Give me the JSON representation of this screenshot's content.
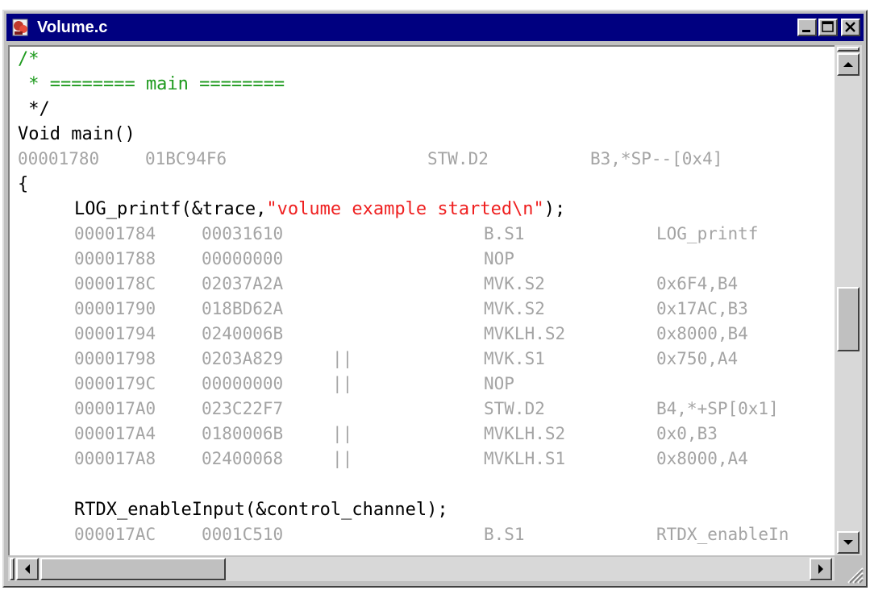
{
  "window": {
    "title": "Volume.c",
    "icon": "ccs-source-file-icon",
    "controls": [
      "minimize-icon",
      "maximize-icon",
      "close-icon"
    ]
  },
  "code": {
    "comment": [
      "/*",
      " * ======== main ========",
      " */"
    ],
    "main_signature": "Void main()",
    "main_asm": [
      "00001780",
      "01BC94F6",
      "",
      "STW.D2",
      "B3,*SP--[0x4]"
    ],
    "open_brace": "{",
    "log_call_prefix": "LOG_printf(&trace,",
    "log_call_string": "\"volume example started\\n\"",
    "log_call_suffix": ");",
    "log_asm": [
      [
        "00001784",
        "00031610",
        "",
        "B.S1",
        "LOG_printf"
      ],
      [
        "00001788",
        "00000000",
        "",
        "NOP",
        ""
      ],
      [
        "0000178C",
        "02037A2A",
        "",
        "MVK.S2",
        "0x6F4,B4"
      ],
      [
        "00001790",
        "018BD62A",
        "",
        "MVK.S2",
        "0x17AC,B3"
      ],
      [
        "00001794",
        "0240006B",
        "",
        "MVKLH.S2",
        "0x8000,B4"
      ],
      [
        "00001798",
        "0203A829",
        "||",
        "MVK.S1",
        "0x750,A4"
      ],
      [
        "0000179C",
        "00000000",
        "||",
        "NOP",
        ""
      ],
      [
        "000017A0",
        "023C22F7",
        "",
        "STW.D2",
        "B4,*+SP[0x1]"
      ],
      [
        "000017A4",
        "0180006B",
        "||",
        "MVKLH.S2",
        "0x0,B3"
      ],
      [
        "000017A8",
        "02400068",
        "||",
        "MVKLH.S1",
        "0x8000,A4"
      ]
    ],
    "rtdx_call": "RTDX_enableInput(&control_channel);",
    "rtdx_asm": [
      "000017AC",
      "0001C510",
      "",
      "B.S1",
      "RTDX_enableIn"
    ]
  }
}
